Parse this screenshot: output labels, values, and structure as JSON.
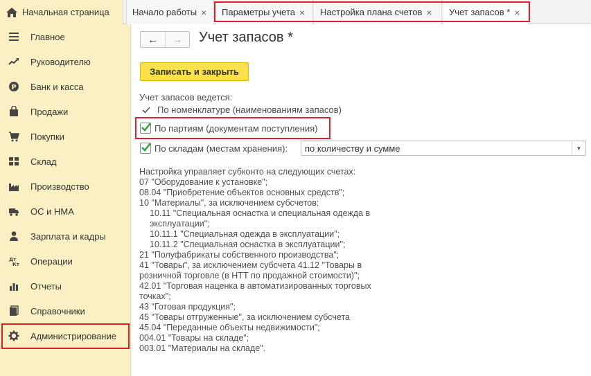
{
  "tabs": {
    "home": "Начальная страница",
    "start": "Начало работы",
    "params": "Параметры учета",
    "plan": "Настройка плана счетов",
    "active": "Учет запасов *",
    "close_glyph": "×"
  },
  "sidebar": {
    "items": [
      {
        "label": "Главное",
        "icon": "menu-icon"
      },
      {
        "label": "Руководителю",
        "icon": "trend-icon"
      },
      {
        "label": "Банк и касса",
        "icon": "ruble-coin-icon"
      },
      {
        "label": "Продажи",
        "icon": "shopping-bag-icon"
      },
      {
        "label": "Покупки",
        "icon": "cart-icon"
      },
      {
        "label": "Склад",
        "icon": "warehouse-grid-icon"
      },
      {
        "label": "Производство",
        "icon": "factory-icon"
      },
      {
        "label": "ОС и НМА",
        "icon": "truck-icon"
      },
      {
        "label": "Зарплата и кадры",
        "icon": "person-icon"
      },
      {
        "label": "Операции",
        "icon": "dt-kt-icon"
      },
      {
        "label": "Отчеты",
        "icon": "bar-chart-icon"
      },
      {
        "label": "Справочники",
        "icon": "books-icon"
      },
      {
        "label": "Администрирование",
        "icon": "gear-icon"
      }
    ]
  },
  "main": {
    "back_glyph": "←",
    "forward_glyph": "→",
    "title": "Учет запасов *",
    "save_button": "Записать и закрыть",
    "accounting_label": "Учет запасов ведется:",
    "by_nomenclature": "По номенклатуре (наименованиям запасов)",
    "by_batches": "По партиям (документам поступления)",
    "by_batches_checked": true,
    "by_warehouses": "По складам (местам хранения):",
    "by_warehouses_checked": true,
    "warehouse_mode": "по количеству и сумме",
    "info_lines": [
      "Настройка управляет субконто на следующих счетах:",
      "07 \"Оборудование к установке\";",
      "08.04 \"Приобретение объектов основных средств\";",
      "10 \"Материалы\", за исключением субсчетов:",
      "10.11 \"Специальная оснастка и специальная одежда в эксплуатации\";",
      "10.11.1 \"Специальная одежда в эксплуатации\";",
      "10.11.2 \"Специальная оснастка в эксплуатации\";",
      "21 \"Полуфабрикаты собственного производства\";",
      "41 \"Товары\", за исключением субсчета 41.12 \"Товары в розничной торговле (в НТТ по продажной стоимости)\";",
      "42.01 \"Торговая наценка в автоматизированных торговых точках\";",
      "43 \"Готовая продукция\";",
      "45 \"Товары отгруженные\", за исключением субсчета",
      "45.04 \"Переданные объекты недвижимости\";",
      "004.01 \"Товары на складе\";",
      "003.01 \"Материалы на складе\"."
    ]
  },
  "colors": {
    "sidebar_bg": "#fbf0c3",
    "accent_button": "#fbe14b",
    "highlight_frame": "#d8232a",
    "checkbox_green": "#3aa33a"
  }
}
